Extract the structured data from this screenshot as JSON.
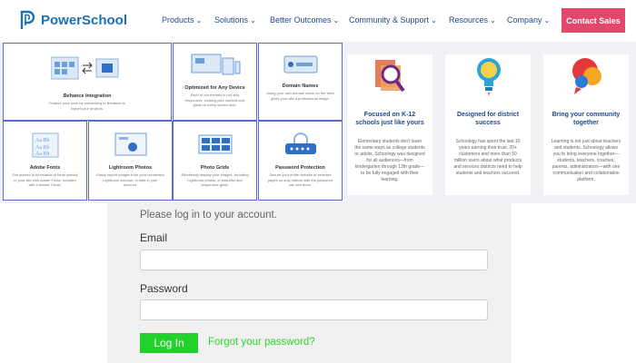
{
  "brand": {
    "name": "PowerSchool",
    "color": "#1f6fb5"
  },
  "nav": {
    "items": [
      {
        "label": "Products",
        "icon": "chevron-down-icon"
      },
      {
        "label": "Solutions",
        "icon": "chevron-down-icon"
      },
      {
        "label": "Better Outcomes",
        "icon": "chevron-down-icon"
      },
      {
        "label": "Community & Support",
        "icon": "chevron-down-icon"
      },
      {
        "label": "Resources",
        "icon": "chevron-down-icon"
      },
      {
        "label": "Company",
        "icon": "chevron-down-icon"
      }
    ],
    "contact_label": "Contact Sales",
    "contact_color": "#e3476c"
  },
  "dropdown": {
    "accent": "#5b69c9",
    "cards": [
      {
        "title": "Behance Integration",
        "desc": "Feature your work by connecting to Behance to import your projects.",
        "icon": "integration-icon"
      },
      {
        "title": "Optimized for Any Device",
        "desc": "Each of our themes is not only responsive, making your content look great on every screen size.",
        "icon": "devices-icon"
      },
      {
        "title": "Domain Names",
        "desc": "Using your own domain name on the Web gives your site a professional image.",
        "icon": "domain-icon"
      },
      {
        "title": "Adobe Fonts",
        "desc": "Get access to thousands of fonts directly in your site with Adobe Fonts, included with Creative Cloud.",
        "icon": "fonts-icon"
      },
      {
        "title": "Lightroom Photos",
        "desc": "Easily import images from your connected Lightroom account. Create in your account.",
        "icon": "photos-icon"
      },
      {
        "title": "Photo Grids",
        "desc": "Effortlessly display your images, including Lightroom photos, in beautiful and responsive grids.",
        "icon": "grid-icon"
      },
      {
        "title": "Password Protection",
        "desc": "Secure your entire website or selected pages so only visitors with the password can see them.",
        "icon": "password-icon"
      }
    ]
  },
  "sections": [
    {
      "title": "Focused on K-12 schools just like yours",
      "body": "Elementary students don't learn the same ways as college students or adults. Schoology was designed for all audiences—from kindergarten through 12th grade—to be fully engaged with their learning.",
      "icon": "magnifier-icon",
      "color": "#e2683c"
    },
    {
      "title": "Designed for district success",
      "body": "Schoology has spent the last 10 years earning their trust, 20+ customers and more than 50 million users about what products and services districts need to help students and teachers succeed.",
      "icon": "lightbulb-icon",
      "color": "#2aa5db"
    },
    {
      "title": "Bring your community together",
      "body": "Learning is not just about teachers and students. Schoology allows you to bring everyone together—students, teachers, coaches, parents, administrators—with one communication and collaboration platform.",
      "icon": "chat-icon",
      "color": "#e23a3a"
    }
  ],
  "login": {
    "prompt": "Please log in to your account.",
    "email_label": "Email",
    "email_value": "",
    "password_label": "Password",
    "password_value": "",
    "login_button": "Log In",
    "forgot_link": "Forgot your password?",
    "button_color": "#22d12c"
  }
}
